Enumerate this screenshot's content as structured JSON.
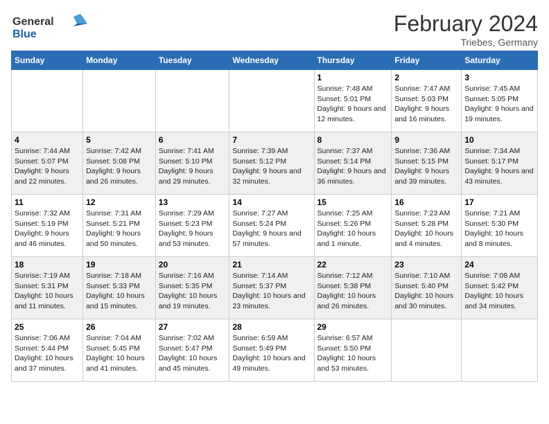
{
  "logo": {
    "text1": "General",
    "text2": "Blue"
  },
  "title": "February 2024",
  "subtitle": "Triebes, Germany",
  "days_header": [
    "Sunday",
    "Monday",
    "Tuesday",
    "Wednesday",
    "Thursday",
    "Friday",
    "Saturday"
  ],
  "weeks": [
    [
      {
        "num": "",
        "info": ""
      },
      {
        "num": "",
        "info": ""
      },
      {
        "num": "",
        "info": ""
      },
      {
        "num": "",
        "info": ""
      },
      {
        "num": "1",
        "info": "Sunrise: 7:48 AM\nSunset: 5:01 PM\nDaylight: 9 hours\nand 12 minutes."
      },
      {
        "num": "2",
        "info": "Sunrise: 7:47 AM\nSunset: 5:03 PM\nDaylight: 9 hours\nand 16 minutes."
      },
      {
        "num": "3",
        "info": "Sunrise: 7:45 AM\nSunset: 5:05 PM\nDaylight: 9 hours\nand 19 minutes."
      }
    ],
    [
      {
        "num": "4",
        "info": "Sunrise: 7:44 AM\nSunset: 5:07 PM\nDaylight: 9 hours\nand 22 minutes."
      },
      {
        "num": "5",
        "info": "Sunrise: 7:42 AM\nSunset: 5:08 PM\nDaylight: 9 hours\nand 26 minutes."
      },
      {
        "num": "6",
        "info": "Sunrise: 7:41 AM\nSunset: 5:10 PM\nDaylight: 9 hours\nand 29 minutes."
      },
      {
        "num": "7",
        "info": "Sunrise: 7:39 AM\nSunset: 5:12 PM\nDaylight: 9 hours\nand 32 minutes."
      },
      {
        "num": "8",
        "info": "Sunrise: 7:37 AM\nSunset: 5:14 PM\nDaylight: 9 hours\nand 36 minutes."
      },
      {
        "num": "9",
        "info": "Sunrise: 7:36 AM\nSunset: 5:15 PM\nDaylight: 9 hours\nand 39 minutes."
      },
      {
        "num": "10",
        "info": "Sunrise: 7:34 AM\nSunset: 5:17 PM\nDaylight: 9 hours\nand 43 minutes."
      }
    ],
    [
      {
        "num": "11",
        "info": "Sunrise: 7:32 AM\nSunset: 5:19 PM\nDaylight: 9 hours\nand 46 minutes."
      },
      {
        "num": "12",
        "info": "Sunrise: 7:31 AM\nSunset: 5:21 PM\nDaylight: 9 hours\nand 50 minutes."
      },
      {
        "num": "13",
        "info": "Sunrise: 7:29 AM\nSunset: 5:23 PM\nDaylight: 9 hours\nand 53 minutes."
      },
      {
        "num": "14",
        "info": "Sunrise: 7:27 AM\nSunset: 5:24 PM\nDaylight: 9 hours\nand 57 minutes."
      },
      {
        "num": "15",
        "info": "Sunrise: 7:25 AM\nSunset: 5:26 PM\nDaylight: 10 hours\nand 1 minute."
      },
      {
        "num": "16",
        "info": "Sunrise: 7:23 AM\nSunset: 5:28 PM\nDaylight: 10 hours\nand 4 minutes."
      },
      {
        "num": "17",
        "info": "Sunrise: 7:21 AM\nSunset: 5:30 PM\nDaylight: 10 hours\nand 8 minutes."
      }
    ],
    [
      {
        "num": "18",
        "info": "Sunrise: 7:19 AM\nSunset: 5:31 PM\nDaylight: 10 hours\nand 11 minutes."
      },
      {
        "num": "19",
        "info": "Sunrise: 7:18 AM\nSunset: 5:33 PM\nDaylight: 10 hours\nand 15 minutes."
      },
      {
        "num": "20",
        "info": "Sunrise: 7:16 AM\nSunset: 5:35 PM\nDaylight: 10 hours\nand 19 minutes."
      },
      {
        "num": "21",
        "info": "Sunrise: 7:14 AM\nSunset: 5:37 PM\nDaylight: 10 hours\nand 23 minutes."
      },
      {
        "num": "22",
        "info": "Sunrise: 7:12 AM\nSunset: 5:38 PM\nDaylight: 10 hours\nand 26 minutes."
      },
      {
        "num": "23",
        "info": "Sunrise: 7:10 AM\nSunset: 5:40 PM\nDaylight: 10 hours\nand 30 minutes."
      },
      {
        "num": "24",
        "info": "Sunrise: 7:08 AM\nSunset: 5:42 PM\nDaylight: 10 hours\nand 34 minutes."
      }
    ],
    [
      {
        "num": "25",
        "info": "Sunrise: 7:06 AM\nSunset: 5:44 PM\nDaylight: 10 hours\nand 37 minutes."
      },
      {
        "num": "26",
        "info": "Sunrise: 7:04 AM\nSunset: 5:45 PM\nDaylight: 10 hours\nand 41 minutes."
      },
      {
        "num": "27",
        "info": "Sunrise: 7:02 AM\nSunset: 5:47 PM\nDaylight: 10 hours\nand 45 minutes."
      },
      {
        "num": "28",
        "info": "Sunrise: 6:59 AM\nSunset: 5:49 PM\nDaylight: 10 hours\nand 49 minutes."
      },
      {
        "num": "29",
        "info": "Sunrise: 6:57 AM\nSunset: 5:50 PM\nDaylight: 10 hours\nand 53 minutes."
      },
      {
        "num": "",
        "info": ""
      },
      {
        "num": "",
        "info": ""
      }
    ]
  ]
}
